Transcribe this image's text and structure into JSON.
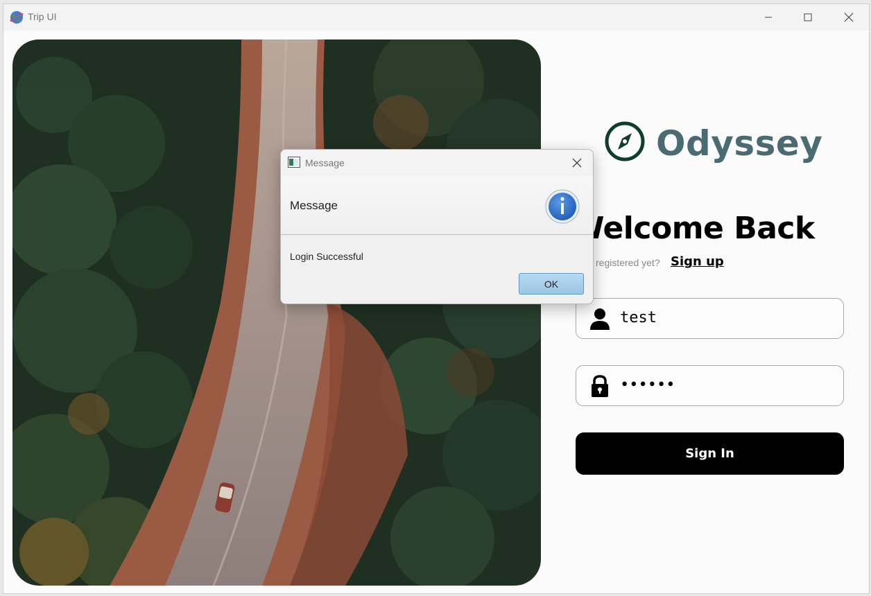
{
  "window": {
    "title": "Trip UI",
    "controls": {
      "minimize": "minimize",
      "maximize": "maximize",
      "close": "close"
    }
  },
  "hero_image": {
    "subject": "aerial view of a dirt road through a pine forest with a car"
  },
  "brand": {
    "name": "Odyssey",
    "icon": "compass-icon",
    "color": "#4a6b71"
  },
  "login": {
    "heading": "Welcome Back",
    "signup_prompt": "registered yet?",
    "signup_link": "Sign up",
    "username_value": "test",
    "password_value": "••••••",
    "signin_label": "Sign In"
  },
  "dialog": {
    "title": "Message",
    "heading": "Message",
    "body": "Login Successful",
    "ok_label": "OK"
  }
}
